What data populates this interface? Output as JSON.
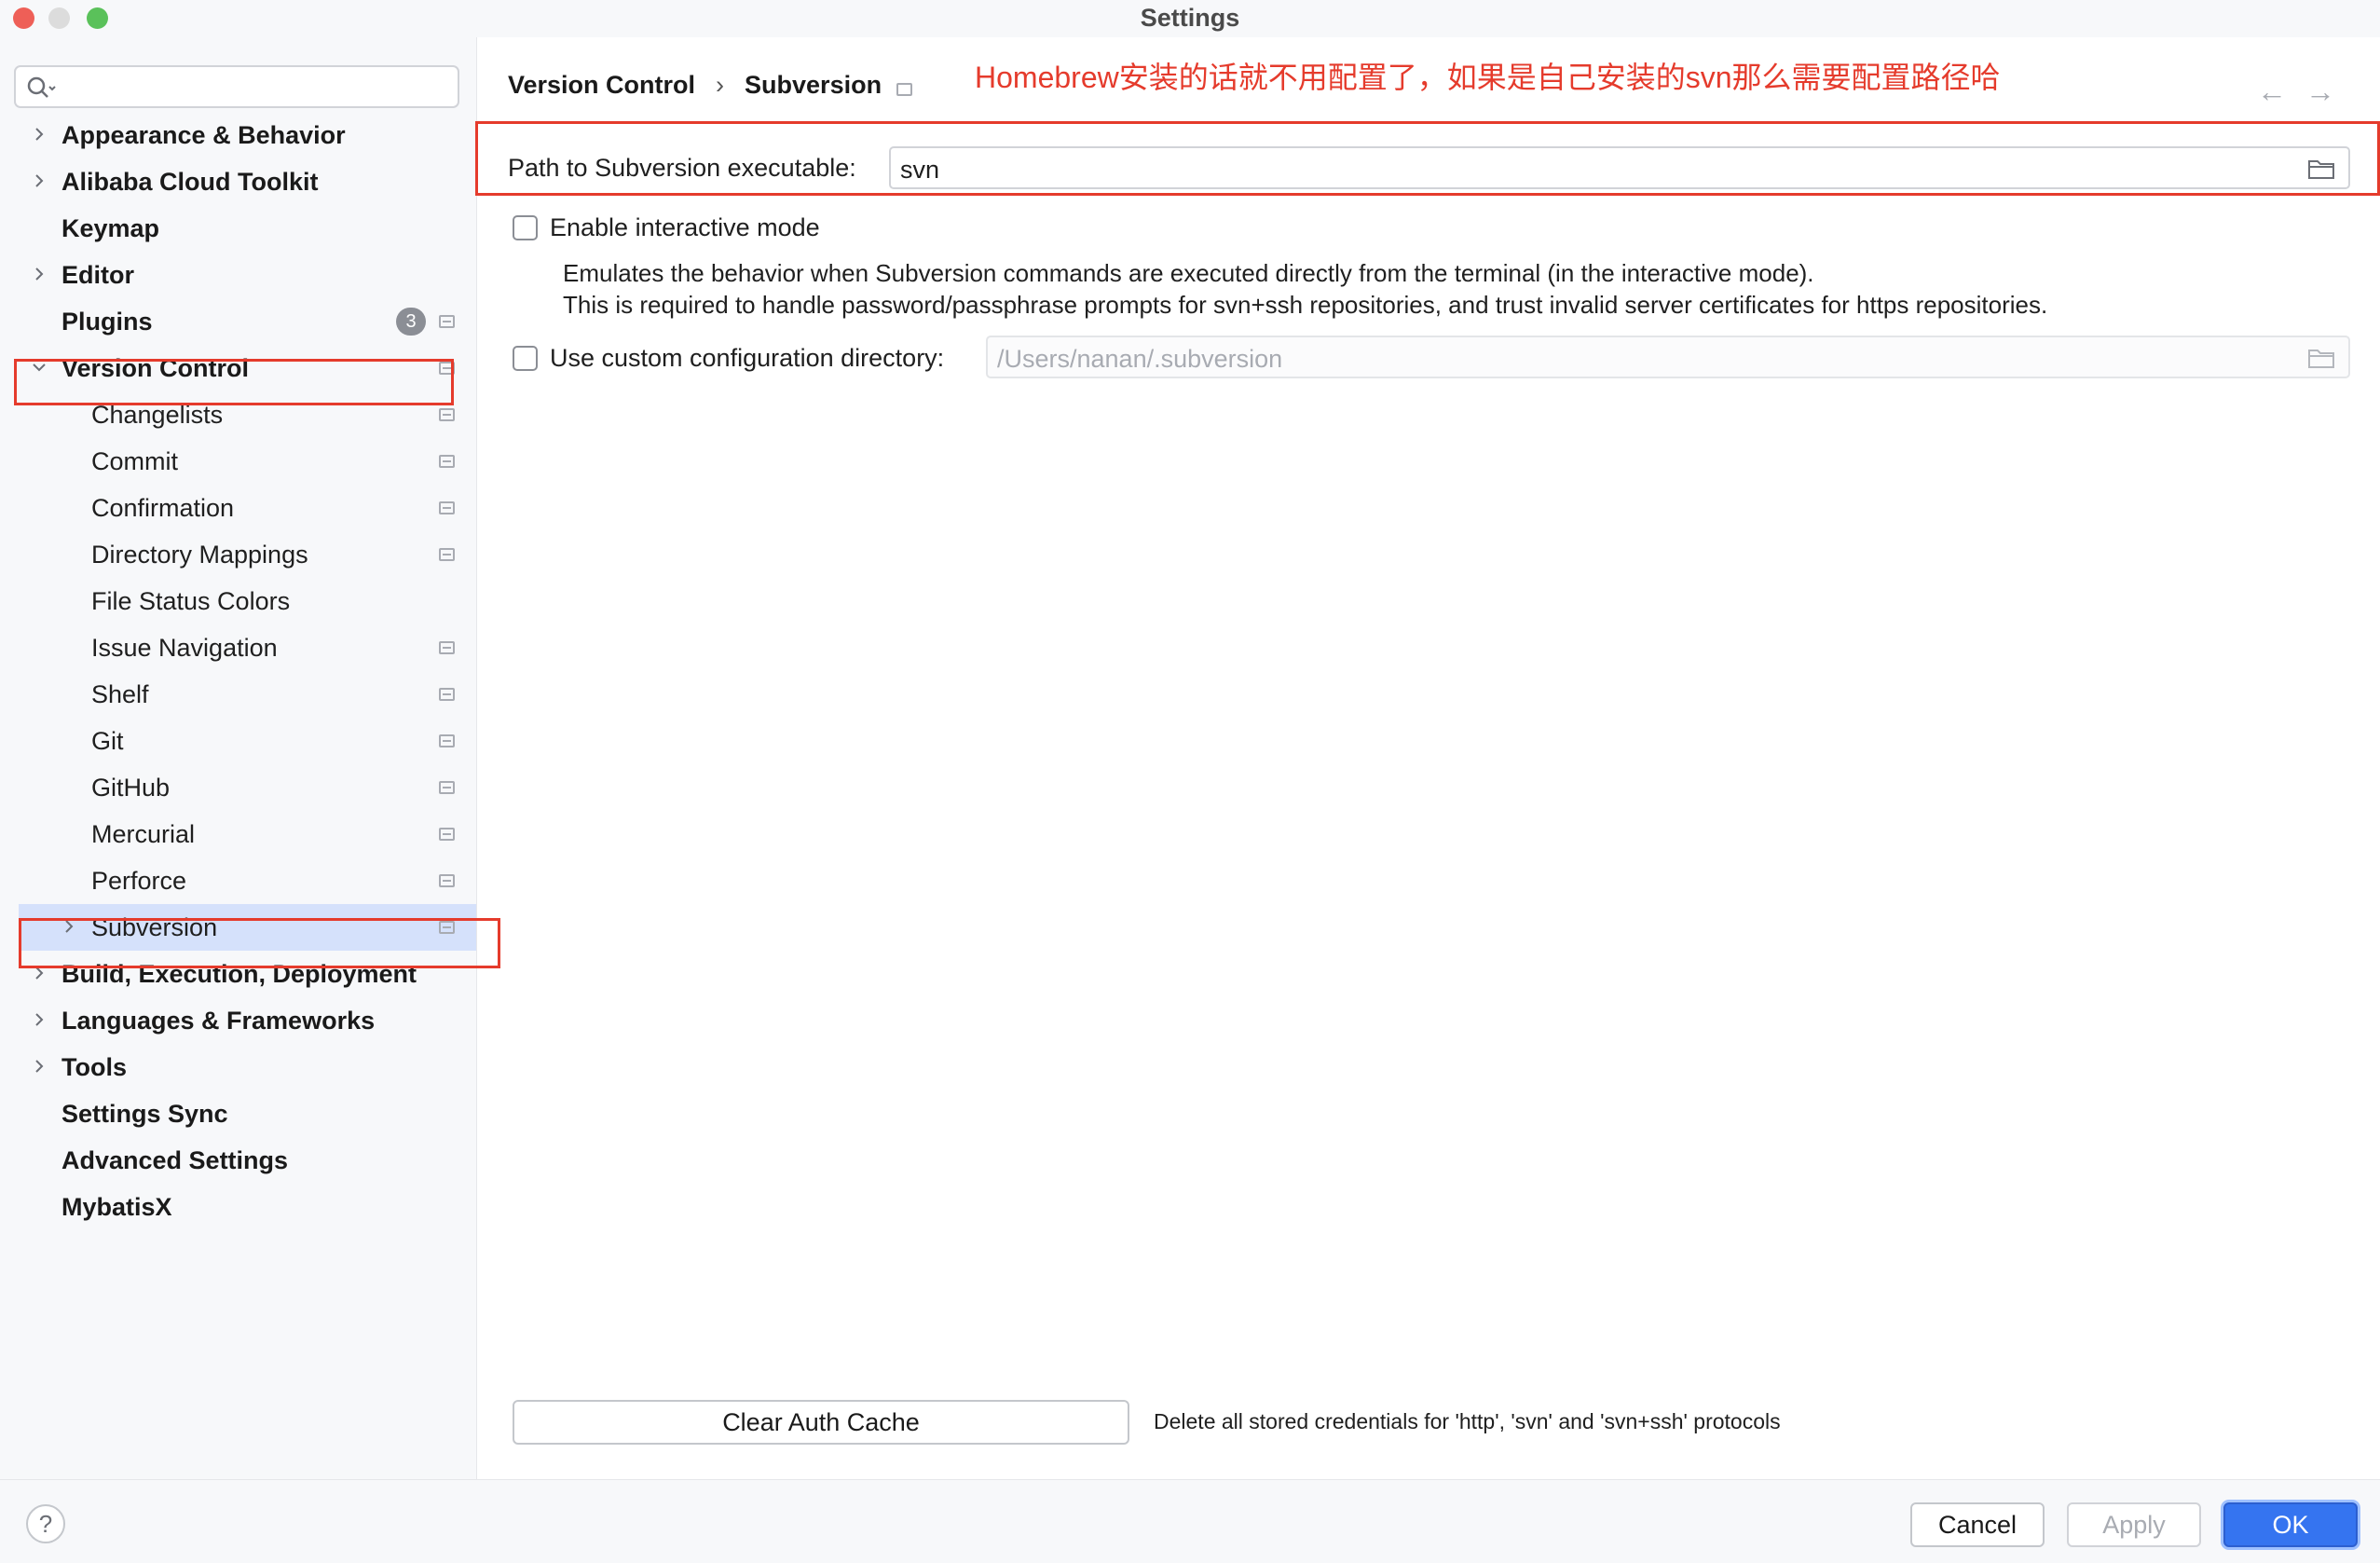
{
  "window": {
    "title": "Settings"
  },
  "search": {
    "placeholder": ""
  },
  "sidebar": {
    "items": [
      {
        "label": "Appearance & Behavior",
        "level": 0,
        "bold": true,
        "expandable": true,
        "expanded": false
      },
      {
        "label": "Alibaba Cloud Toolkit",
        "level": 0,
        "bold": true,
        "expandable": true,
        "expanded": false
      },
      {
        "label": "Keymap",
        "level": 0,
        "bold": true,
        "expandable": false
      },
      {
        "label": "Editor",
        "level": 0,
        "bold": true,
        "expandable": true,
        "expanded": false
      },
      {
        "label": "Plugins",
        "level": 0,
        "bold": true,
        "expandable": false,
        "badge": "3",
        "page_icon": true
      },
      {
        "label": "Version Control",
        "level": 0,
        "bold": true,
        "expandable": true,
        "expanded": true,
        "page_icon": true
      },
      {
        "label": "Changelists",
        "level": 1,
        "page_icon": true
      },
      {
        "label": "Commit",
        "level": 1,
        "page_icon": true
      },
      {
        "label": "Confirmation",
        "level": 1,
        "page_icon": true
      },
      {
        "label": "Directory Mappings",
        "level": 1,
        "page_icon": true
      },
      {
        "label": "File Status Colors",
        "level": 1,
        "page_icon": false
      },
      {
        "label": "Issue Navigation",
        "level": 1,
        "page_icon": true
      },
      {
        "label": "Shelf",
        "level": 1,
        "page_icon": true
      },
      {
        "label": "Git",
        "level": 1,
        "page_icon": true
      },
      {
        "label": "GitHub",
        "level": 1,
        "page_icon": true
      },
      {
        "label": "Mercurial",
        "level": 1,
        "page_icon": true
      },
      {
        "label": "Perforce",
        "level": 1,
        "page_icon": true
      },
      {
        "label": "Subversion",
        "level": 1,
        "expandable": true,
        "expanded": false,
        "selected": true,
        "page_icon": true
      },
      {
        "label": "Build, Execution, Deployment",
        "level": 0,
        "bold": true,
        "expandable": true,
        "expanded": false
      },
      {
        "label": "Languages & Frameworks",
        "level": 0,
        "bold": true,
        "expandable": true,
        "expanded": false
      },
      {
        "label": "Tools",
        "level": 0,
        "bold": true,
        "expandable": true,
        "expanded": false
      },
      {
        "label": "Settings Sync",
        "level": 0,
        "bold": true,
        "expandable": false
      },
      {
        "label": "Advanced Settings",
        "level": 0,
        "bold": true,
        "expandable": false
      },
      {
        "label": "MybatisX",
        "level": 0,
        "bold": true,
        "expandable": false
      }
    ]
  },
  "breadcrumb": {
    "parent": "Version Control",
    "separator": "›",
    "current": "Subversion"
  },
  "annotation": {
    "text": "Homebrew安装的话就不用配置了，如果是自己安装的svn那么需要配置路径哈",
    "color": "#e53b2c"
  },
  "nav": {
    "back": "←",
    "forward": "→"
  },
  "path_field": {
    "label": "Path to Subversion executable:",
    "value": "svn"
  },
  "interactive_mode": {
    "label": "Enable interactive mode",
    "checked": false,
    "desc_line1": "Emulates the behavior when Subversion commands are executed directly from the terminal (in the interactive mode).",
    "desc_line2": "This is required to handle password/passphrase prompts for svn+ssh repositories, and trust invalid server certificates for https repositories."
  },
  "custom_config": {
    "label": "Use custom configuration directory:",
    "checked": false,
    "placeholder": "/Users/nanan/.subversion"
  },
  "clear_auth": {
    "button": "Clear Auth Cache",
    "desc": "Delete all stored credentials for 'http', 'svn' and 'svn+ssh' protocols"
  },
  "footer": {
    "help": "?",
    "cancel": "Cancel",
    "apply": "Apply",
    "ok": "OK"
  },
  "colors": {
    "accent": "#3574f0",
    "selection": "#d5e1fb",
    "highlight_box": "#e53b2c"
  }
}
